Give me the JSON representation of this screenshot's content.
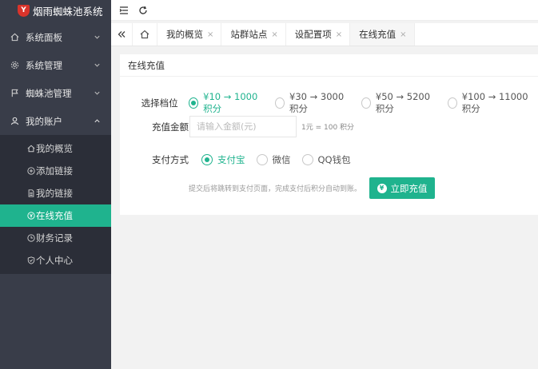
{
  "app": {
    "title": "烟雨蜘蛛池系统",
    "logo_mark": "Y"
  },
  "sidebar": {
    "items": [
      {
        "label": "系统面板"
      },
      {
        "label": "系统管理"
      },
      {
        "label": "蜘蛛池管理"
      },
      {
        "label": "我的账户"
      }
    ],
    "account_sub": [
      {
        "label": "我的概览"
      },
      {
        "label": "添加链接"
      },
      {
        "label": "我的链接"
      },
      {
        "label": "在线充值"
      },
      {
        "label": "财务记录"
      },
      {
        "label": "个人中心"
      }
    ]
  },
  "tabs": [
    {
      "label": "我的概览",
      "close": "×"
    },
    {
      "label": "站群站点",
      "close": "×"
    },
    {
      "label": "设配置项",
      "close": "×"
    },
    {
      "label": "在线充值",
      "close": "×"
    }
  ],
  "recharge": {
    "card_title": "在线充值",
    "tier_label": "选择档位",
    "tiers": [
      {
        "label": "¥10 → 1000积分"
      },
      {
        "label": "¥30 → 3000积分"
      },
      {
        "label": "¥50 → 5200积分"
      },
      {
        "label": "¥100 → 11000积分"
      }
    ],
    "amount_label": "充值金额",
    "amount_placeholder": "请输入金额(元)",
    "amount_hint": "1元 = 100 积分",
    "method_label": "支付方式",
    "methods": [
      {
        "label": "支付宝"
      },
      {
        "label": "微信"
      },
      {
        "label": "QQ钱包"
      }
    ],
    "note": "提交后将跳转到支付页面，完成支付后积分自动到账。",
    "submit_label": "立即充值",
    "submit_icon_glyph": "¥"
  },
  "colors": {
    "accent": "#1fb38e",
    "sidebar_bg": "#393d49",
    "submenu_bg": "#2b2e38",
    "logo_red": "#d9342b"
  }
}
